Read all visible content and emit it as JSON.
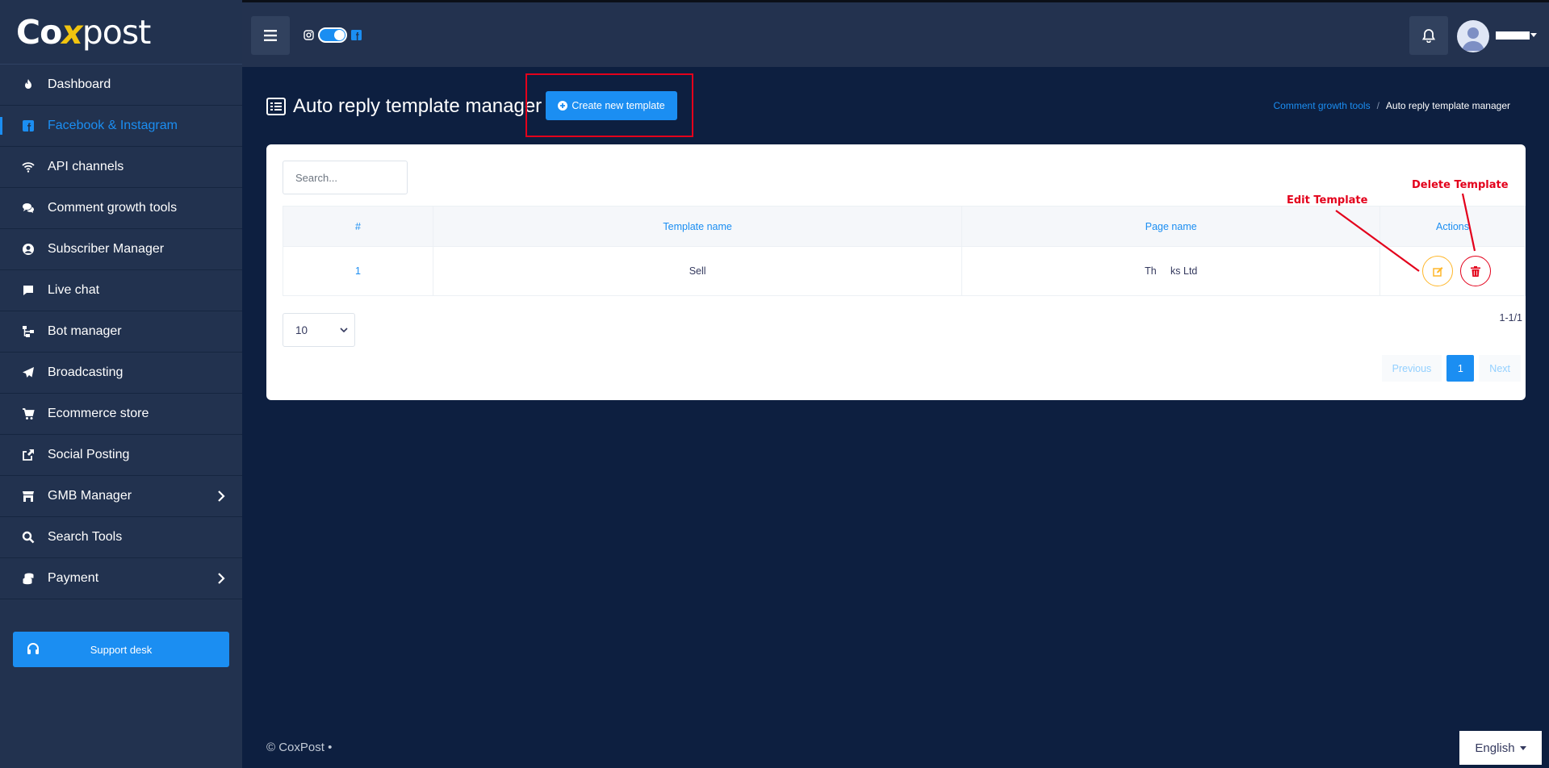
{
  "brand": {
    "logo_prefix": "Co",
    "logo_x": "x",
    "logo_suffix": "post"
  },
  "sidebar": {
    "items": [
      {
        "label": "Dashboard",
        "icon": "fire-icon"
      },
      {
        "label": "Facebook & Instagram",
        "icon": "facebook-icon",
        "active": true
      },
      {
        "label": "API channels",
        "icon": "wifi-icon"
      },
      {
        "label": "Comment growth tools",
        "icon": "comments-icon"
      },
      {
        "label": "Subscriber Manager",
        "icon": "user-circle-icon"
      },
      {
        "label": "Live chat",
        "icon": "chat-bubble-icon"
      },
      {
        "label": "Bot manager",
        "icon": "sitemap-icon"
      },
      {
        "label": "Broadcasting",
        "icon": "paper-plane-icon"
      },
      {
        "label": "Ecommerce store",
        "icon": "shopping-cart-icon"
      },
      {
        "label": "Social Posting",
        "icon": "share-square-icon"
      },
      {
        "label": "GMB Manager",
        "icon": "store-icon",
        "has_submenu": true
      },
      {
        "label": "Search Tools",
        "icon": "search-icon"
      },
      {
        "label": "Payment",
        "icon": "coins-icon",
        "has_submenu": true
      }
    ],
    "support_label": "Support desk"
  },
  "page": {
    "title": "Auto reply template manager",
    "create_button": "Create new template",
    "breadcrumb": {
      "parent": "Comment growth tools",
      "current": "Auto reply template manager"
    }
  },
  "table": {
    "search_placeholder": "Search...",
    "columns": [
      "#",
      "Template name",
      "Page name",
      "Actions"
    ],
    "rows": [
      {
        "index": "1",
        "template_name": "Sell",
        "page_name": "Th     ks Ltd"
      }
    ],
    "page_length": "10",
    "count_text": "1-1/1",
    "pagination": {
      "previous": "Previous",
      "current": "1",
      "next": "Next"
    }
  },
  "annotations": {
    "edit": "Edit Template",
    "delete": "Delete Template"
  },
  "footer": {
    "copyright": "© CoxPost  •",
    "language": "English"
  },
  "colors": {
    "accent": "#1b8ef2",
    "sidebar": "#22324f",
    "background": "#0d1f40",
    "annotation": "#e3001b",
    "edit": "#ffb72b"
  }
}
